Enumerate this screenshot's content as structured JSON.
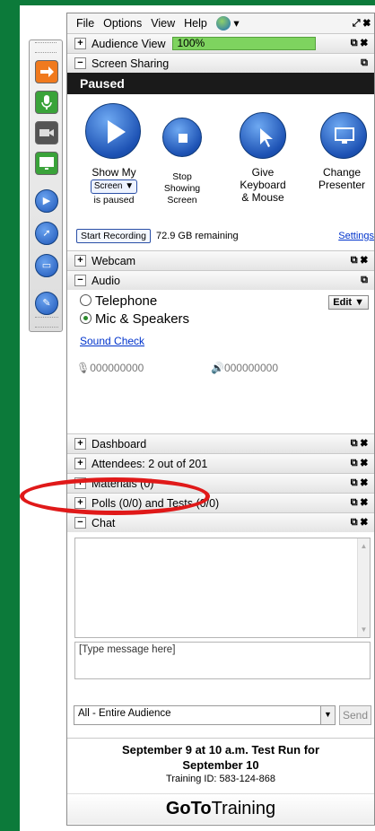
{
  "menu": {
    "file": "File",
    "options": "Options",
    "view": "View",
    "help": "Help",
    "window_controls": "⤢ ✖"
  },
  "audience_view": {
    "label": "Audience View",
    "progress_text": "100%",
    "progress": 1.0
  },
  "screen_sharing": {
    "title": "Screen Sharing",
    "status": "Paused",
    "show_my": "Show My",
    "screen_select": "Screen ▼",
    "is_paused": "is paused",
    "stop_line1": "Stop",
    "stop_line2": "Showing",
    "stop_line3": "Screen",
    "give_line1": "Give",
    "give_line2": "Keyboard",
    "give_line3": "& Mouse",
    "change_line1": "Change",
    "change_line2": "Presenter",
    "start_recording": "Start Recording",
    "remaining": "72.9 GB remaining",
    "settings": "Settings"
  },
  "webcam": {
    "title": "Webcam"
  },
  "audio": {
    "title": "Audio",
    "telephone": "Telephone",
    "mic_speakers": "Mic & Speakers",
    "edit": "Edit ▼",
    "sound_check": "Sound Check",
    "mic_level": "🎙000000000",
    "spk_level": "🔊000000000"
  },
  "dashboard": {
    "title": "Dashboard"
  },
  "attendees": {
    "title": "Attendees:  2 out of 201"
  },
  "materials": {
    "title": "Materials (0)"
  },
  "polls": {
    "title": "Polls (0/0) and Tests (0/0)"
  },
  "chat": {
    "title": "Chat",
    "placeholder": "[Type message here]",
    "audience": "All - Entire Audience",
    "send": "Send"
  },
  "session": {
    "title_line1": "September 9 at 10 a.m. Test Run for",
    "title_line2": "September 10",
    "training_id": "Training ID: 583-124-868",
    "logo_bold": "GoTo",
    "logo_light": "Training"
  },
  "colors": {
    "brand_green": "#0c7a3a",
    "progress_green": "#7ed35f",
    "highlight_red": "#e01919",
    "button_blue": "#1d52b4"
  }
}
